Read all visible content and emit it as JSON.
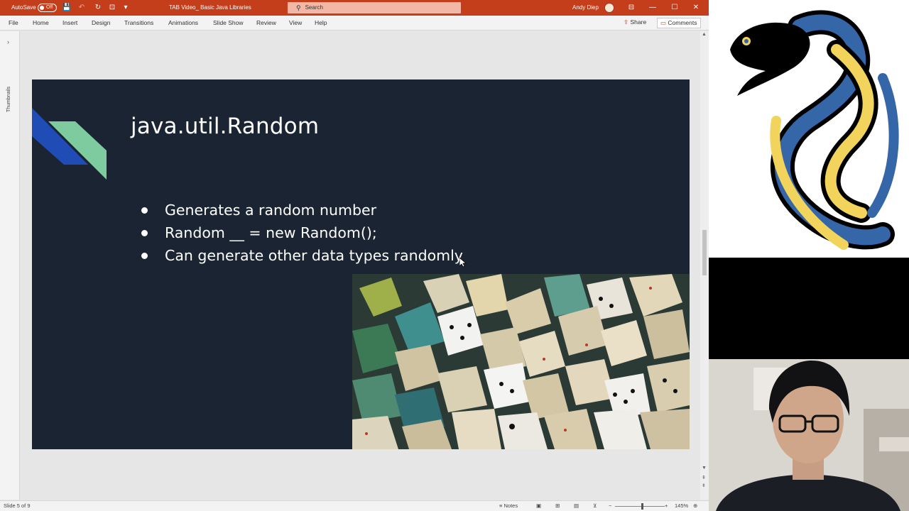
{
  "titlebar": {
    "autosave_label": "AutoSave",
    "autosave_state": "Off",
    "document_title": "TAB Video_ Basic Java Libraries",
    "search_placeholder": "Search",
    "user_name": "Andy Diep"
  },
  "menu": {
    "items": [
      "File",
      "Home",
      "Insert",
      "Design",
      "Transitions",
      "Animations",
      "Slide Show",
      "Review",
      "View",
      "Help"
    ],
    "share_label": "Share",
    "comments_label": "Comments"
  },
  "thumbnails_label": "Thumbnails",
  "slide": {
    "title": "java.util.Random",
    "bullets": [
      "Generates a random number",
      "Random __ = new Random();",
      "Can generate other data types randomly"
    ]
  },
  "statusbar": {
    "slide_info": "Slide 5 of 9",
    "notes_label": "Notes",
    "zoom_level": "145%"
  },
  "colors": {
    "ribbon": "#c43e1c",
    "slide_bg": "#1b2432",
    "deco_blue": "#1f4db5",
    "deco_green": "#7ecba0"
  }
}
